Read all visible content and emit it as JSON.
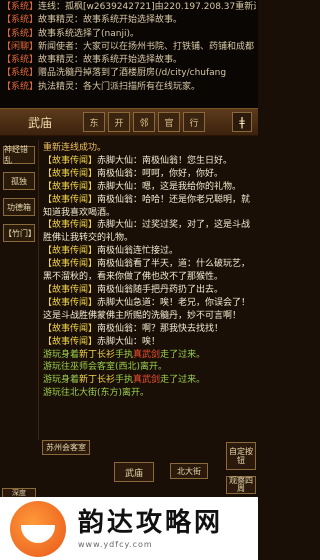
{
  "top_log": [
    {
      "tag": "【系统】",
      "text": "连线：孤枫[w2639242721]由220.197.208.37重新连线"
    },
    {
      "tag": "【系统】",
      "text": "故事精灵：故事系统开始选择故事。"
    },
    {
      "tag": "【系统】",
      "text": "故事系统选择了(nanji)。"
    },
    {
      "tag": "【闲聊】",
      "text": "新闻使者：大家可以在扬州书院、打铁铺、药铺和成都"
    },
    {
      "tag": "【系统】",
      "text": "故事精灵：故事系统开始选择故事。"
    },
    {
      "tag": "【系统】",
      "text": "赠品洗髓丹掉落到了酒楼厨房(/d/city/chufang"
    },
    {
      "tag": "【系统】",
      "text": "执法精灵：各大门派扫描所有在线玩家。"
    }
  ],
  "title_bar": {
    "room": "武庙",
    "buttons": [
      "东",
      "开",
      "邻",
      "官",
      "行"
    ],
    "exit_icon": "ǂ"
  },
  "left_buttons": [
    "神经错乱",
    "孤独",
    "功德箱",
    "【竹门】"
  ],
  "messages": [
    {
      "segments": [
        {
          "t": "重新连线成功。",
          "c": "gold"
        }
      ]
    },
    {
      "segments": [
        {
          "t": "【故事传闻】",
          "c": "yellow"
        },
        {
          "t": "赤脚大仙：南极仙翁！您生日好。",
          "c": "white"
        }
      ]
    },
    {
      "segments": [
        {
          "t": "【故事传闻】",
          "c": "yellow"
        },
        {
          "t": "南极仙翁：呵呵，你好，你好。",
          "c": "white"
        }
      ]
    },
    {
      "segments": [
        {
          "t": "【故事传闻】",
          "c": "yellow"
        },
        {
          "t": "赤脚大仙：嗯，这是我给你的礼物。",
          "c": "white"
        }
      ]
    },
    {
      "segments": [
        {
          "t": "【故事传闻】",
          "c": "yellow"
        },
        {
          "t": "南极仙翁：哈哈！还是你老兄聪明，就知道我喜欢喝酒。",
          "c": "white"
        }
      ]
    },
    {
      "segments": [
        {
          "t": "【故事传闻】",
          "c": "yellow"
        },
        {
          "t": "赤脚大仙：过奖过奖，对了，这是斗战胜佛让我转交的礼物。",
          "c": "white"
        }
      ]
    },
    {
      "segments": [
        {
          "t": "【故事传闻】",
          "c": "yellow"
        },
        {
          "t": "南极仙翁连忙接过。",
          "c": "white"
        }
      ]
    },
    {
      "segments": [
        {
          "t": "【故事传闻】",
          "c": "yellow"
        },
        {
          "t": "南极仙翁看了半天，道：什么破玩艺，黑不溜秋的，看来你做了佛也改不了那猴性。",
          "c": "white"
        }
      ]
    },
    {
      "segments": [
        {
          "t": "【故事传闻】",
          "c": "yellow"
        },
        {
          "t": "南极仙翁随手把丹药扔了出去。",
          "c": "white"
        }
      ]
    },
    {
      "segments": [
        {
          "t": "【故事传闻】",
          "c": "yellow"
        },
        {
          "t": "赤脚大仙急道：唉！老兄，你误会了！这是斗战胜佛蒙佛主所赐的洗髓丹，妙不可言啊！",
          "c": "white"
        }
      ]
    },
    {
      "segments": [
        {
          "t": "【故事传闻】",
          "c": "yellow"
        },
        {
          "t": "南极仙翁：啊？那我快去找找！",
          "c": "white"
        }
      ]
    },
    {
      "segments": [
        {
          "t": "【故事传闻】",
          "c": "yellow"
        },
        {
          "t": "赤脚大仙：唉！",
          "c": "white"
        }
      ]
    },
    {
      "segments": [
        {
          "t": "游玩身着",
          "c": "green"
        },
        {
          "t": "新丁长衫",
          "c": "yellow"
        },
        {
          "t": "手执",
          "c": "green"
        },
        {
          "t": "真武剑",
          "c": "red"
        },
        {
          "t": "走了过来。",
          "c": "green"
        }
      ]
    },
    {
      "segments": [
        {
          "t": "游玩往巫师会客室(西北)离开。",
          "c": "green"
        }
      ]
    },
    {
      "segments": [
        {
          "t": "游玩身着",
          "c": "green"
        },
        {
          "t": "新丁长衫",
          "c": "yellow"
        },
        {
          "t": "手执",
          "c": "green"
        },
        {
          "t": "真武剑",
          "c": "red"
        },
        {
          "t": "走了过来。",
          "c": "green"
        }
      ]
    },
    {
      "segments": [
        {
          "t": "游玩往北大街(东方)离开。",
          "c": "green"
        }
      ]
    }
  ],
  "bottom": {
    "blessing": "苏州会客室",
    "right_top": "自定按钮",
    "center": "武庙",
    "east": "北大街",
    "observe": "观察四周",
    "left_bottom": "深度"
  },
  "banner": {
    "name": "韵达攻略网",
    "url": "www.ydfcy.com"
  }
}
